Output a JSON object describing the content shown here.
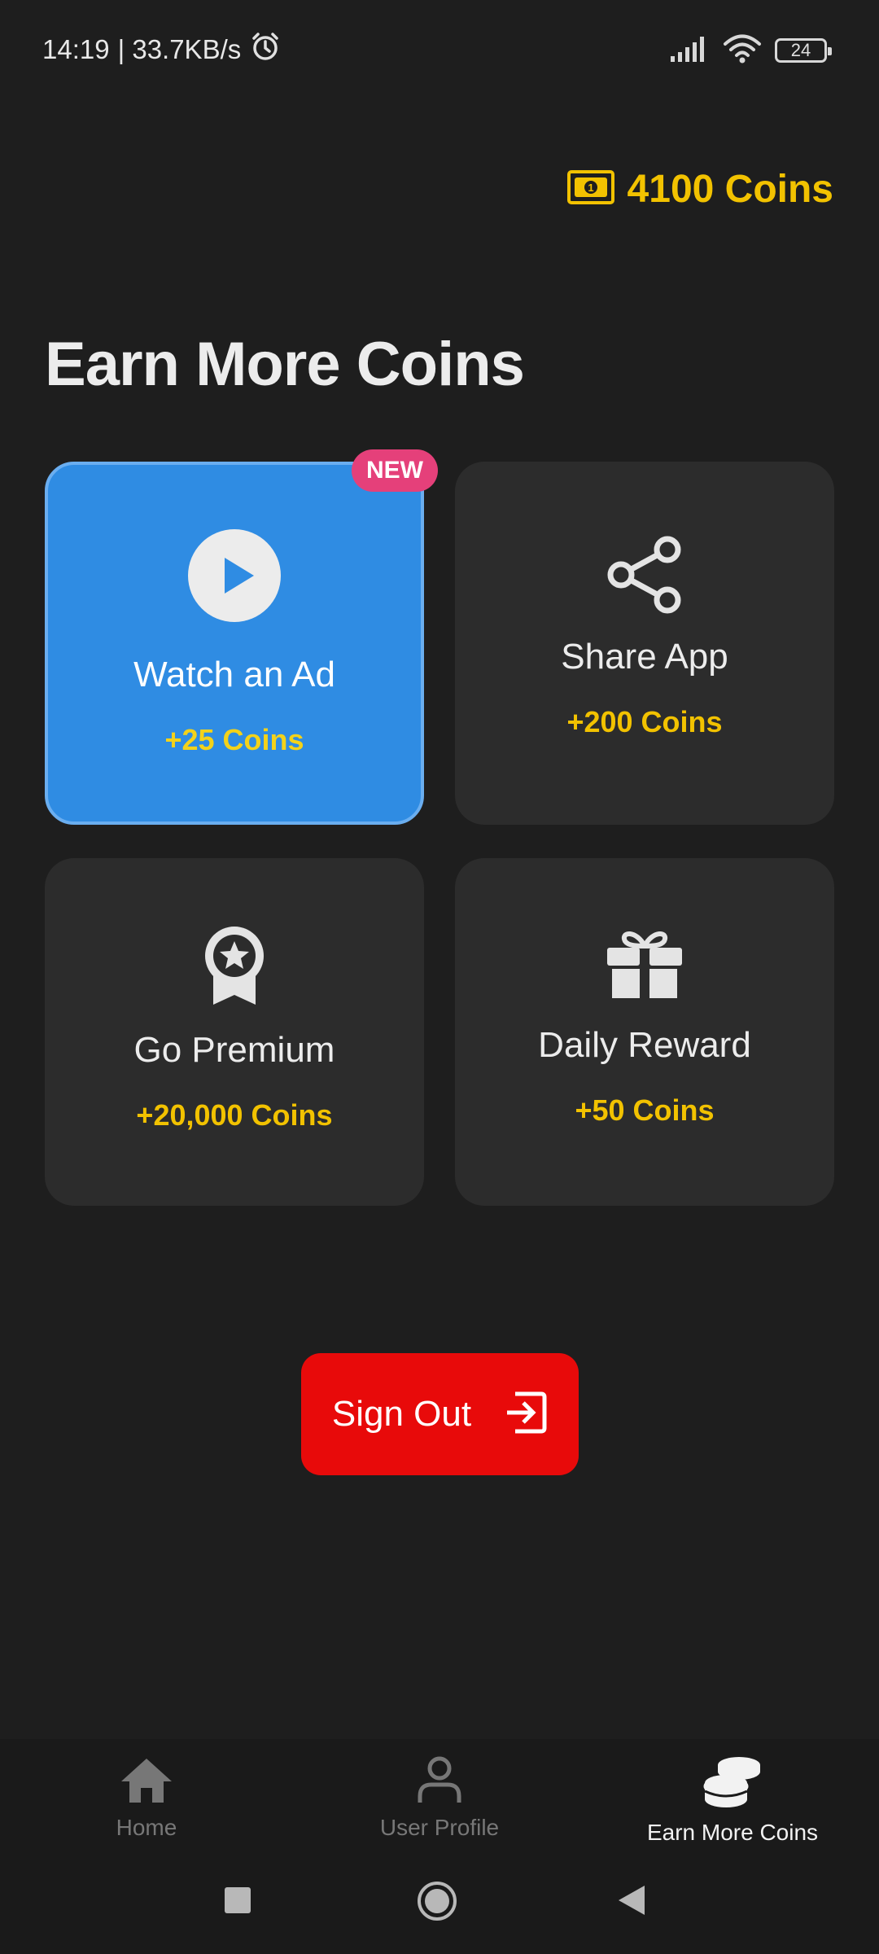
{
  "status_bar": {
    "time": "14:19",
    "speed": "| 33.7KB/s",
    "battery": "24"
  },
  "header": {
    "coins_display": "4100 Coins"
  },
  "main": {
    "title": "Earn More Coins",
    "new_badge": "NEW",
    "cards": [
      {
        "label": "Watch an Ad",
        "reward": "+25 Coins",
        "icon": "play-circle-icon"
      },
      {
        "label": "Share App",
        "reward": "+200 Coins",
        "icon": "share-icon"
      },
      {
        "label": "Go Premium",
        "reward": "+20,000 Coins",
        "icon": "award-badge-icon"
      },
      {
        "label": "Daily Reward",
        "reward": "+50 Coins",
        "icon": "gift-icon"
      }
    ],
    "sign_out_label": "Sign Out"
  },
  "bottom_nav": {
    "items": [
      {
        "label": "Home",
        "icon": "home-icon",
        "active": false
      },
      {
        "label": "User Profile",
        "icon": "user-icon",
        "active": false
      },
      {
        "label": "Earn More Coins",
        "icon": "coins-stack-icon",
        "active": true
      }
    ]
  },
  "colors": {
    "background": "#1e1e1e",
    "card": "#2c2c2c",
    "active_card": "#2f8ce3",
    "coin_yellow": "#f2c200",
    "badge_pink": "#e5407a",
    "sign_out_red": "#e80a0a"
  }
}
